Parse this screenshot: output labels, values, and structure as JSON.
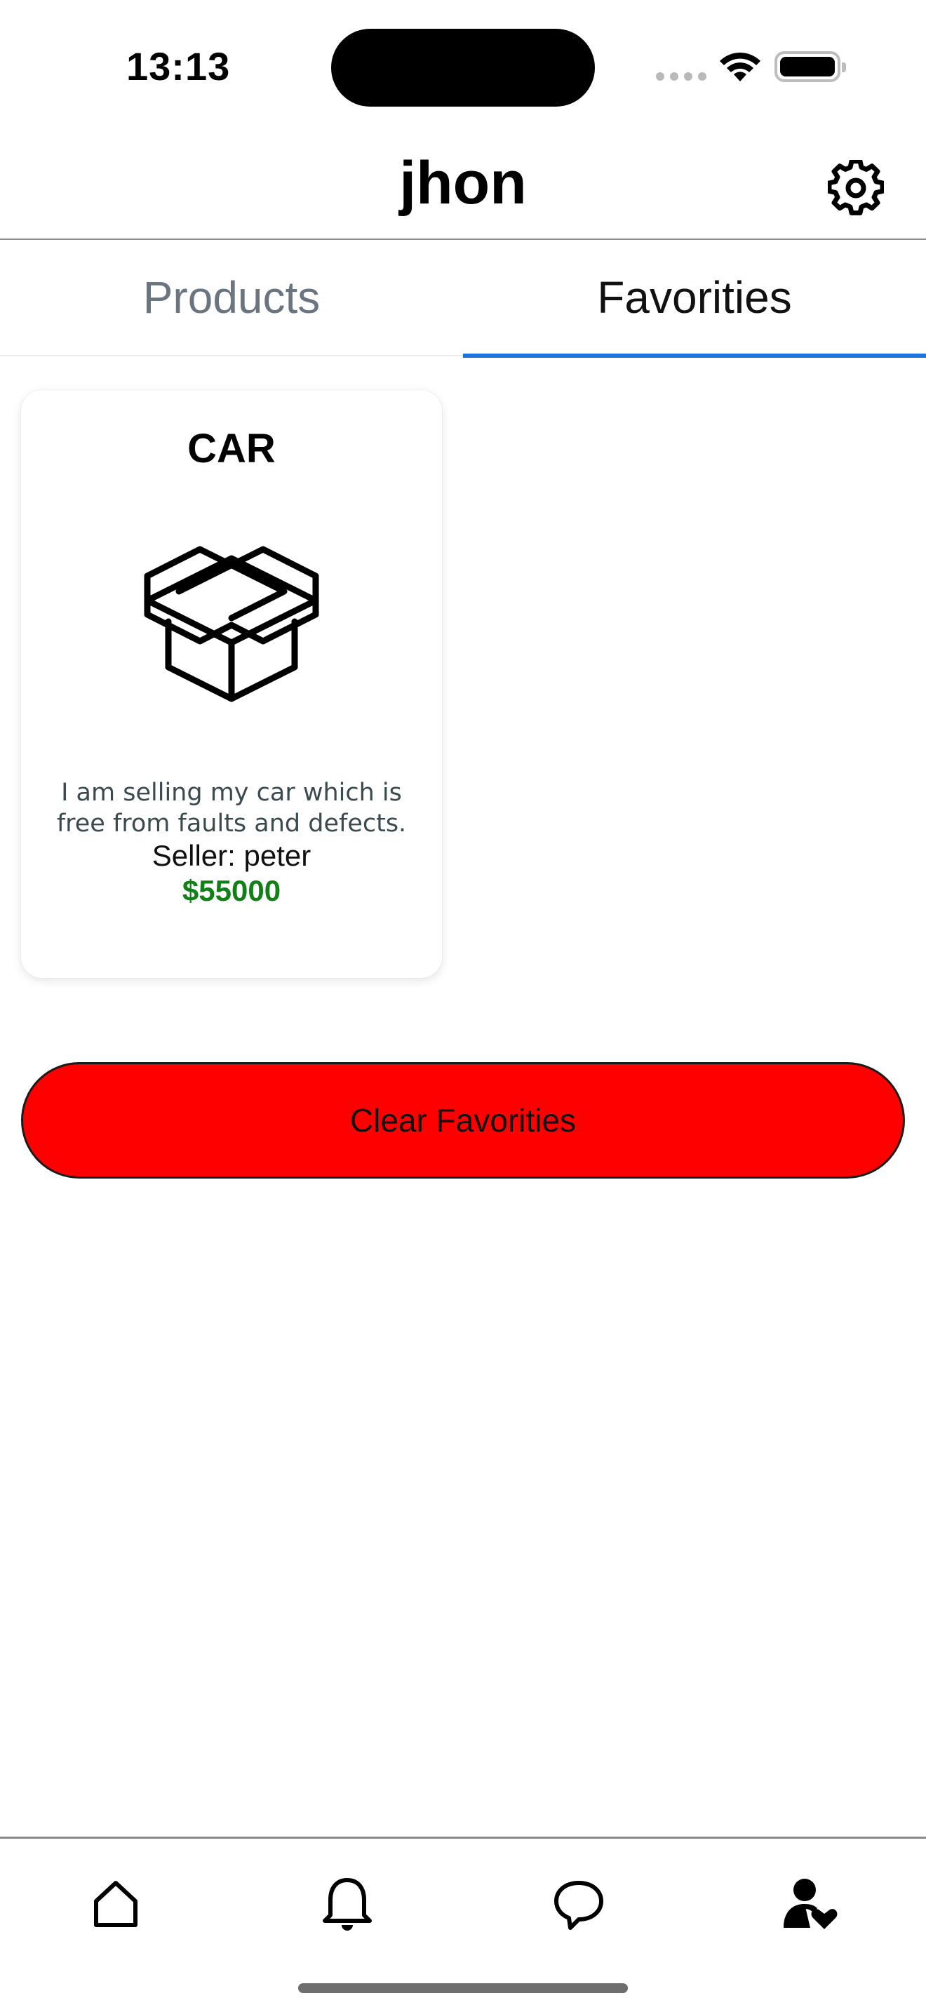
{
  "status_bar": {
    "time": "13:13",
    "icons": [
      "signal-icon",
      "wifi-icon",
      "battery-icon"
    ]
  },
  "header": {
    "title": "jhon",
    "settings_icon": "gear-icon"
  },
  "tabs": [
    {
      "label": "Products",
      "active": false
    },
    {
      "label": "Favorities",
      "active": true
    }
  ],
  "favorites": [
    {
      "title": "CAR",
      "image_icon": "box-icon",
      "description": "I am selling my car which is free from faults and defects.",
      "seller": "Seller: peter",
      "price": "$55000"
    }
  ],
  "clear_button": {
    "label": "Clear Favorities"
  },
  "bottom_nav": {
    "items": [
      {
        "icon": "home-icon"
      },
      {
        "icon": "bell-icon"
      },
      {
        "icon": "chat-icon"
      },
      {
        "icon": "profile-favorites-icon",
        "active": true
      }
    ]
  },
  "colors": {
    "accent": "#1b74e0",
    "price": "#118016",
    "danger": "#ff0000"
  }
}
